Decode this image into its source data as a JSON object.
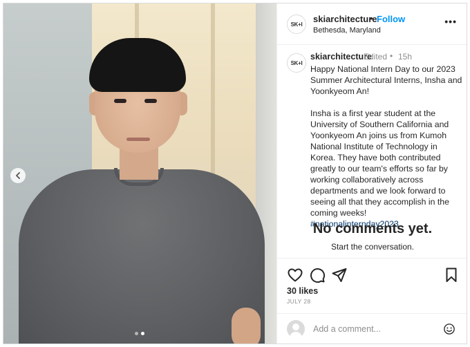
{
  "post": {
    "username": "skiarchitecture",
    "separator": "•",
    "follow_label": "Follow",
    "location": "Bethesda, Maryland",
    "more_label": "•••",
    "avatar_text": "SK+I"
  },
  "caption": {
    "username": "skiarchitecture",
    "edited_label": "Edited",
    "separator": "•",
    "time": "15h",
    "paragraph1": "Happy National Intern Day to our 2023 Summer Architectural Interns, Insha and Yoonkyeom An!",
    "paragraph2": "Insha is a first year student at the University of Southern California and Yoonkyeom An joins us from Kumoh National Institute of Technology in Korea. They have both contributed greatly to our team's efforts so far by working collaboratively across departments and we look forward to seeing all that they accomplish in the coming weeks!",
    "hashtag": "#nationalinternday2023"
  },
  "comments": {
    "empty_title": "No comments yet.",
    "empty_subtitle": "Start the conversation."
  },
  "actions": {
    "like_icon": "heart-icon",
    "comment_icon": "comment-icon",
    "share_icon": "share-icon",
    "save_icon": "bookmark-icon",
    "likes": "30 likes",
    "date": "JULY 28"
  },
  "composer": {
    "placeholder": "Add a comment...",
    "emoji_icon": "emoji-icon"
  },
  "carousel": {
    "slide_count": 2,
    "active_index": 1
  },
  "colors": {
    "follow": "#0095f6",
    "hashtag": "#00376b",
    "muted": "#8e8e8e",
    "text": "#262626"
  }
}
